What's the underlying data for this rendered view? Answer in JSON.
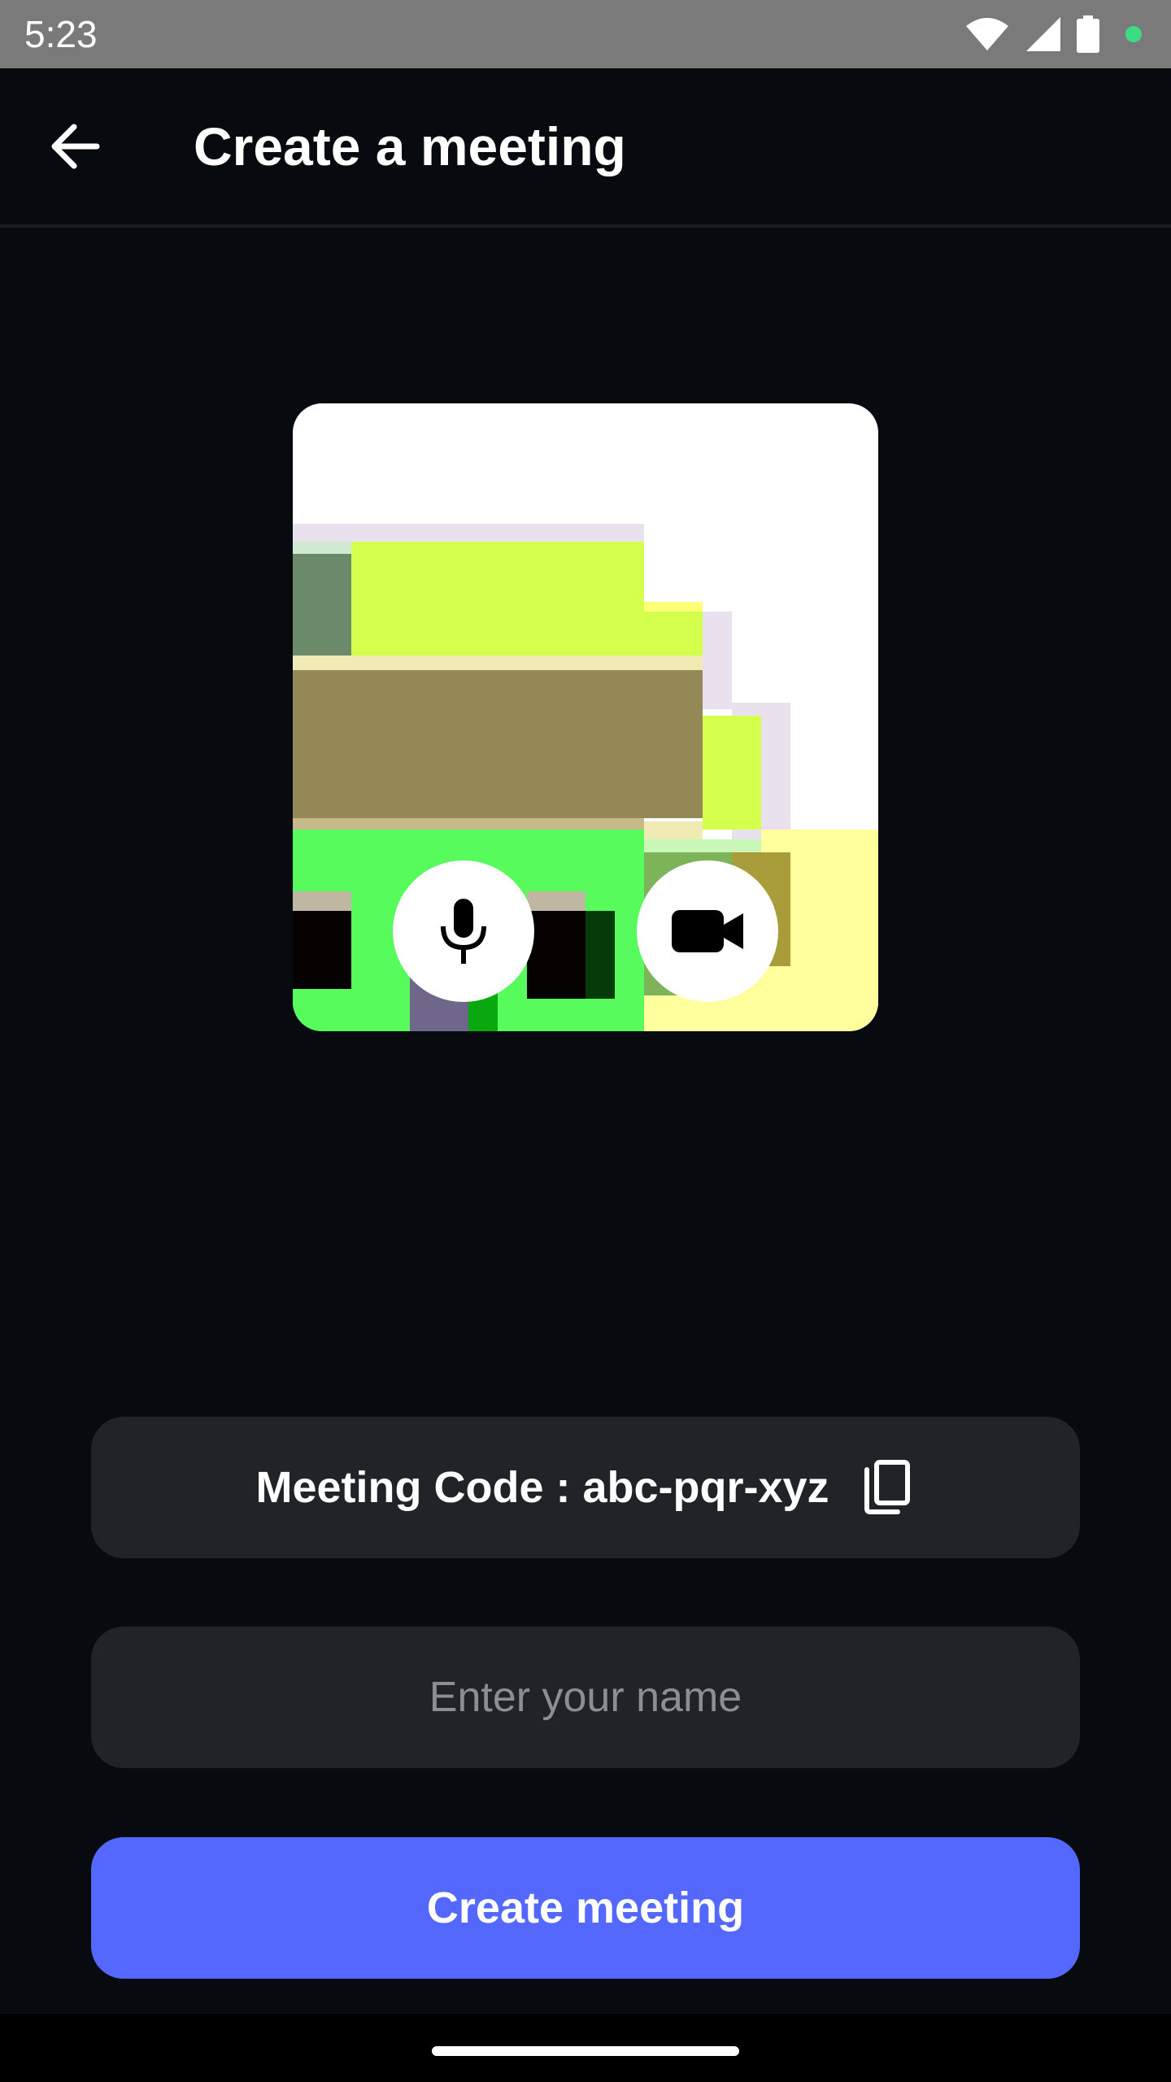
{
  "status_bar": {
    "time": "5:23",
    "icons": [
      "wifi-icon",
      "signal-icon",
      "battery-icon",
      "notification-dot-icon"
    ]
  },
  "app_bar": {
    "title": "Create a meeting",
    "back_icon": "arrow-left-icon"
  },
  "preview": {
    "controls": {
      "mic_icon": "microphone-icon",
      "camera_icon": "video-camera-icon"
    }
  },
  "meeting_code": {
    "text": "Meeting Code : abc-pqr-xyz",
    "copy_icon": "copy-icon"
  },
  "name_input": {
    "placeholder": "Enter your name",
    "value": ""
  },
  "create_button": {
    "label": "Create meeting"
  },
  "colors": {
    "background": "#070b10",
    "field_bg": "#212427",
    "primary": "#5568fe",
    "status_bar": "#7a7a7a",
    "notification_dot": "#3ddc84"
  }
}
